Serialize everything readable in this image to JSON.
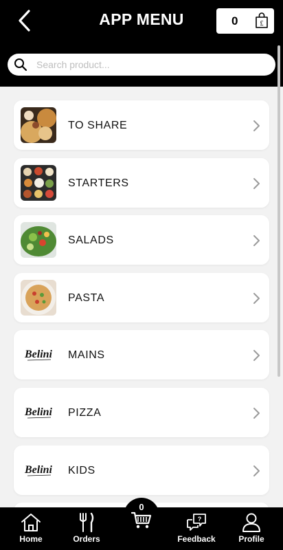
{
  "header": {
    "title": "APP MENU",
    "cart_count": "0",
    "back_icon": "chevron-left-icon",
    "bag_icon": "shopping-bag-pound-icon"
  },
  "search": {
    "placeholder": "Search product...",
    "value": ""
  },
  "categories": [
    {
      "label": "TO SHARE",
      "thumb": "photo"
    },
    {
      "label": "STARTERS",
      "thumb": "photo"
    },
    {
      "label": "SALADS",
      "thumb": "photo"
    },
    {
      "label": "PASTA",
      "thumb": "photo"
    },
    {
      "label": "MAINS",
      "thumb": "logo"
    },
    {
      "label": "PIZZA",
      "thumb": "logo"
    },
    {
      "label": "KIDS",
      "thumb": "logo"
    }
  ],
  "logo_text": "Belini",
  "bottom_nav": {
    "home": "Home",
    "orders": "Orders",
    "cart_count": "0",
    "feedback": "Feedback",
    "profile": "Profile"
  },
  "colors": {
    "header_bg": "#000000",
    "page_bg": "#f2f2f2",
    "card_bg": "#ffffff",
    "chevron": "#9a9a9a"
  }
}
